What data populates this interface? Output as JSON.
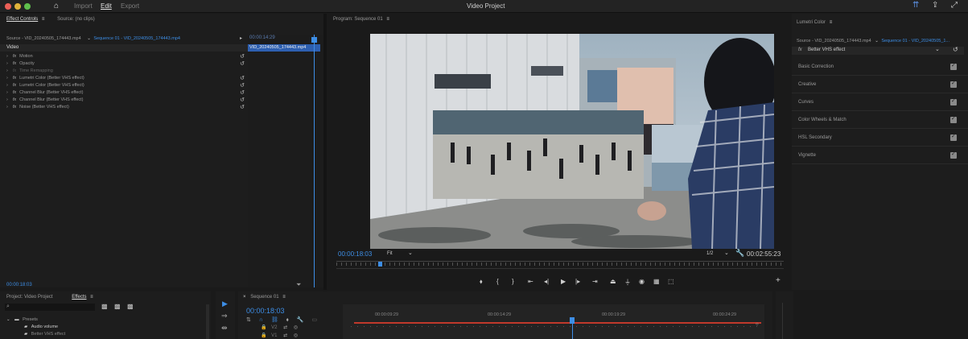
{
  "app": {
    "title": "Video Project",
    "menu": [
      "Import",
      "Edit",
      "Export"
    ]
  },
  "effect_controls": {
    "tabs": [
      "Effect Controls",
      "Source: (no clips)"
    ],
    "source_label": "Source - VID_20240505_174443.mp4",
    "sequence_label": "Sequence 01 - VID_20240505_174443.mp4",
    "section": "Video",
    "effects": [
      {
        "label": "Motion",
        "fx": true
      },
      {
        "label": "Opacity",
        "fx": true
      },
      {
        "label": "Time Remapping",
        "fx": false
      },
      {
        "label": "Lumetri Color (Better VHS effect)",
        "fx": true
      },
      {
        "label": "Lumetri Color (Better VHS effect)",
        "fx": true
      },
      {
        "label": "Channel Blur (Better VHS effect)",
        "fx": true
      },
      {
        "label": "Channel Blur (Better VHS effect)",
        "fx": true
      },
      {
        "label": "Noise (Better VHS effect)",
        "fx": true
      }
    ],
    "mini_timecode": "00:00:14:29",
    "mini_clip": "VID_20240505_174443.mp4",
    "bottom_timecode": "00:00:18:03"
  },
  "program": {
    "title": "Program: Sequence 01",
    "timecode": "00:00:18:03",
    "fit": "Fit",
    "resolution": "1/2",
    "duration": "00:02:55:23"
  },
  "lumetri": {
    "title": "Lumetri Color",
    "source": "Source - VID_20240505_174443.mp4",
    "sequence": "Sequence 01 - VID_20240505_1...",
    "effect": "Better VHS effect",
    "sections": [
      "Basic Correction",
      "Creative",
      "Curves",
      "Color Wheels & Match",
      "HSL Secondary",
      "Vignette"
    ]
  },
  "project": {
    "tabs": [
      "Project: Video Project",
      "Effects"
    ],
    "tree": [
      "Presets",
      "Audio volume",
      "Better VHS effect"
    ]
  },
  "timeline": {
    "title": "Sequence 01",
    "timecode": "00:00:18:03",
    "ruler": [
      "00:00:09:29",
      "00:00:14:29",
      "00:00:19:29",
      "00:00:24:29"
    ],
    "tracks": [
      "V1",
      "V2"
    ]
  }
}
